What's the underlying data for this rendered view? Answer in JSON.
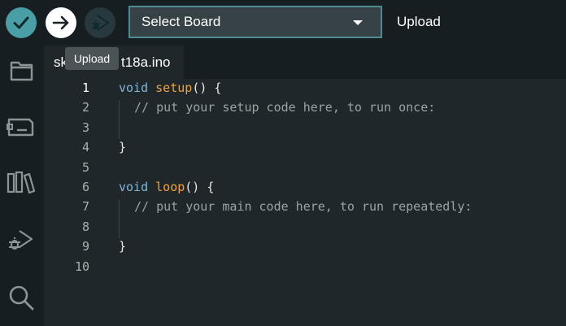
{
  "toolbar": {
    "board_select": "Select Board",
    "upload_label": "Upload"
  },
  "tooltip": {
    "text": "Upload"
  },
  "tab": {
    "title_start": "sk",
    "title_end": "t18a.ino"
  },
  "editor": {
    "line_numbers": [
      "1",
      "2",
      "3",
      "4",
      "5",
      "6",
      "7",
      "8",
      "9",
      "10"
    ],
    "lines": {
      "l1_kw": "void",
      "l1_fn": "setup",
      "l1_rest": "() {",
      "l2_comment": "// put your setup code here, to run once:",
      "l4": "}",
      "l6_kw": "void",
      "l6_fn": "loop",
      "l6_rest": "() {",
      "l7_comment": "// put your main code here, to run repeatedly:",
      "l9": "}"
    }
  },
  "sidebar": {
    "items": [
      "folder-icon",
      "board-icon",
      "library-icon",
      "debug-icon",
      "search-icon"
    ]
  },
  "colors": {
    "toolbar_bg": "#171e21",
    "editor_bg": "#1f272a",
    "accent": "#4a9fa6",
    "keyword": "#7fb6d7",
    "function": "#f2a23a",
    "comment": "#9aa3a5"
  }
}
